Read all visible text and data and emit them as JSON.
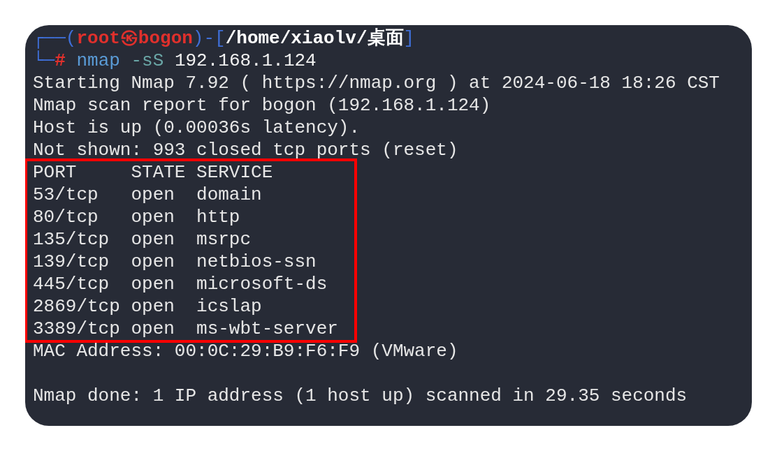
{
  "prompt": {
    "line_1": [
      {
        "text": "┌──(",
        "kind": "frame"
      },
      {
        "text": "root㉿bogon",
        "kind": "user"
      },
      {
        "text": ")-[",
        "kind": "frame"
      },
      {
        "text": "/home/xiaolv/桌面",
        "kind": "path"
      },
      {
        "text": "]",
        "kind": "frame"
      }
    ],
    "line_2": [
      {
        "text": "└─",
        "kind": "frame"
      },
      {
        "text": "#",
        "kind": "user"
      },
      {
        "text": "nmap",
        "kind": "command"
      },
      {
        "text": "-sS",
        "kind": "option"
      },
      {
        "text": "192.168.1.124",
        "kind": "argument"
      }
    ]
  },
  "output_before": [
    "Starting Nmap 7.92 ( https://nmap.org ) at 2024-06-18 18:26 CST",
    "Nmap scan report for bogon (192.168.1.124)",
    "Host is up (0.00036s latency).",
    "Not shown: 993 closed tcp ports (reset)"
  ],
  "highlighted_block": {
    "color": "#ff0000",
    "lines": [
      "PORT     STATE SERVICE",
      "53/tcp   open  domain",
      "80/tcp   open  http",
      "135/tcp  open  msrpc",
      "139/tcp  open  netbios-ssn",
      "445/tcp  open  microsoft-ds",
      "2869/tcp open  icslap",
      "3389/tcp open  ms-wbt-server"
    ]
  },
  "mac_line": "MAC Address: 00:0C:29:B9:F6:F9 (VMware)",
  "summary_line": "Nmap done: 1 IP address (1 host up) scanned in 29.35 seconds"
}
